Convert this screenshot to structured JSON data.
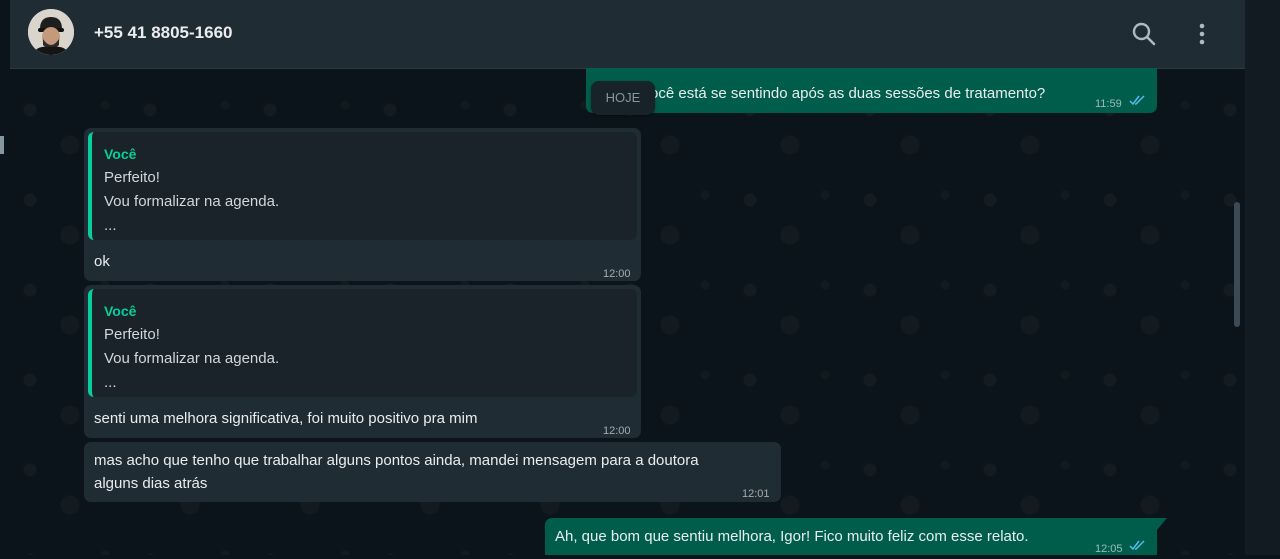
{
  "header": {
    "contact_name": "+55 41 8805-1660",
    "search_icon": "search-icon",
    "menu_icon": "kebab-menu-icon"
  },
  "date_chip": "HOJE",
  "messages": [
    {
      "direction": "outgoing",
      "text": "ocê está se sentindo após as duas sessões de tratamento?",
      "time": "11:59",
      "status": "read"
    },
    {
      "direction": "incoming",
      "quote": {
        "author": "Você",
        "lines": [
          "Perfeito!",
          "Vou formalizar na agenda.",
          "..."
        ]
      },
      "text": "ok",
      "time": "12:00"
    },
    {
      "direction": "incoming",
      "quote": {
        "author": "Você",
        "lines": [
          "Perfeito!",
          "Vou formalizar na agenda.",
          "..."
        ]
      },
      "text": "senti uma melhora significativa, foi muito positivo pra mim",
      "time": "12:00"
    },
    {
      "direction": "incoming",
      "text_lines": [
        "mas acho que tenho que trabalhar alguns pontos ainda, mandei mensagem para a doutora",
        "alguns dias atrás"
      ],
      "time": "12:01"
    },
    {
      "direction": "outgoing",
      "text": "Ah, que bom que sentiu melhora, Igor! Fico muito feliz com esse relato.",
      "time": "12:05",
      "status": "read"
    }
  ],
  "colors": {
    "background": "#0b141a",
    "header": "#202c33",
    "incoming_bubble": "#202c33",
    "outgoing_bubble": "#005c4b",
    "accent": "#06cf9c",
    "read_ticks": "#53bdeb"
  }
}
